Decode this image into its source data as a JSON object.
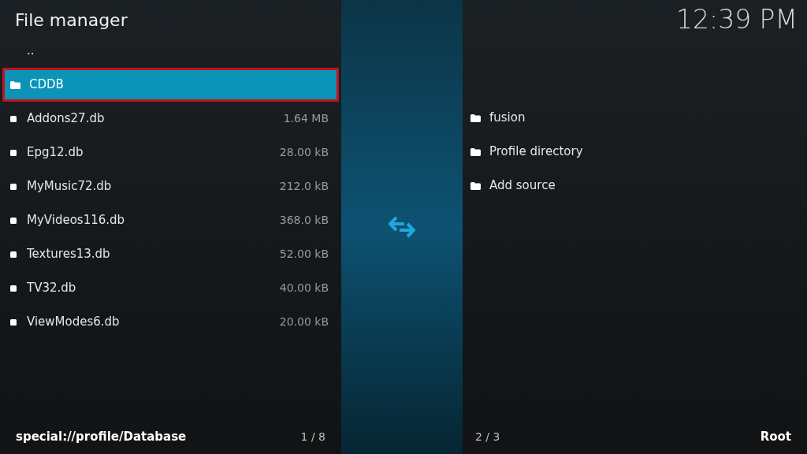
{
  "header": {
    "title": "File manager",
    "clock": "12:39 PM"
  },
  "left_panel": {
    "items": [
      {
        "kind": "parent",
        "name": "..",
        "selected": false
      },
      {
        "kind": "folder",
        "name": "CDDB",
        "selected": true
      },
      {
        "kind": "file",
        "name": "Addons27.db",
        "size": "1.64 MB",
        "selected": false
      },
      {
        "kind": "file",
        "name": "Epg12.db",
        "size": "28.00 kB",
        "selected": false
      },
      {
        "kind": "file",
        "name": "MyMusic72.db",
        "size": "212.0 kB",
        "selected": false
      },
      {
        "kind": "file",
        "name": "MyVideos116.db",
        "size": "368.0 kB",
        "selected": false
      },
      {
        "kind": "file",
        "name": "Textures13.db",
        "size": "52.00 kB",
        "selected": false
      },
      {
        "kind": "file",
        "name": "TV32.db",
        "size": "40.00 kB",
        "selected": false
      },
      {
        "kind": "file",
        "name": "ViewModes6.db",
        "size": "20.00 kB",
        "selected": false
      }
    ],
    "path": "special://profile/Database",
    "count": "1 / 8"
  },
  "right_panel": {
    "items": [
      {
        "kind": "folder",
        "name": "fusion",
        "selected": false
      },
      {
        "kind": "folder",
        "name": "Profile directory",
        "selected": false
      },
      {
        "kind": "folder",
        "name": "Add source",
        "selected": false
      }
    ],
    "count": "2 / 3",
    "path": "Root"
  }
}
